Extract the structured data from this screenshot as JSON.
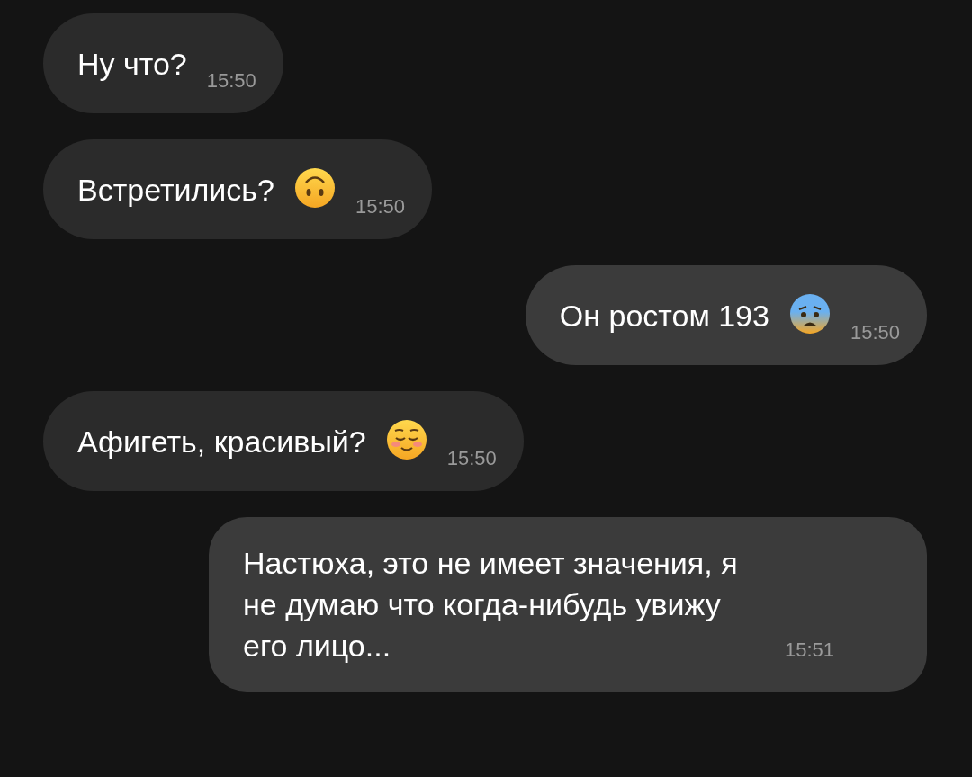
{
  "messages": [
    {
      "kind": "incoming",
      "text": "Ну что?",
      "time": "15:50"
    },
    {
      "kind": "incoming",
      "text": "Встретились?",
      "time": "15:50"
    },
    {
      "kind": "outgoing",
      "text": "Он ростом 193",
      "time": "15:50"
    },
    {
      "kind": "incoming",
      "text": "Афигеть, красивый?",
      "time": "15:50"
    },
    {
      "kind": "outgoing",
      "text": "Настюха, это не имеет значения, я не думаю что когда-нибудь увижу его лицо...",
      "time": "15:51"
    }
  ]
}
